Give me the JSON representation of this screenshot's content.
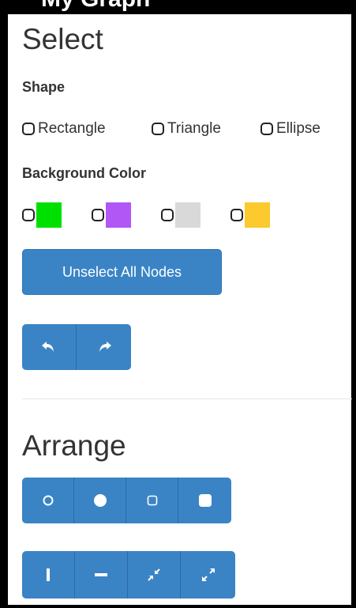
{
  "header_partial_text": "My Graph",
  "select": {
    "title": "Select",
    "shape_label": "Shape",
    "shapes": [
      {
        "label": "Rectangle",
        "checked": false
      },
      {
        "label": "Triangle",
        "checked": false
      },
      {
        "label": "Ellipse",
        "checked": false
      }
    ],
    "background_label": "Background Color",
    "colors": [
      {
        "color": "#00e000",
        "checked": false
      },
      {
        "color": "#b057f5",
        "checked": false
      },
      {
        "color": "#d9d9d9",
        "checked": false
      },
      {
        "color": "#fcc92e",
        "checked": false
      }
    ],
    "unselect_label": "Unselect All Nodes",
    "history_buttons": [
      "undo-icon",
      "redo-icon"
    ]
  },
  "arrange": {
    "title": "Arrange",
    "layout_buttons": [
      "circle-outline-icon",
      "circle-filled-icon",
      "square-outline-icon",
      "square-filled-icon"
    ],
    "direction_buttons": [
      "vertical-bar-icon",
      "horizontal-bar-icon",
      "compress-icon",
      "expand-icon"
    ]
  },
  "colors": {
    "primary": "#3a84c6",
    "text": "#333333"
  }
}
